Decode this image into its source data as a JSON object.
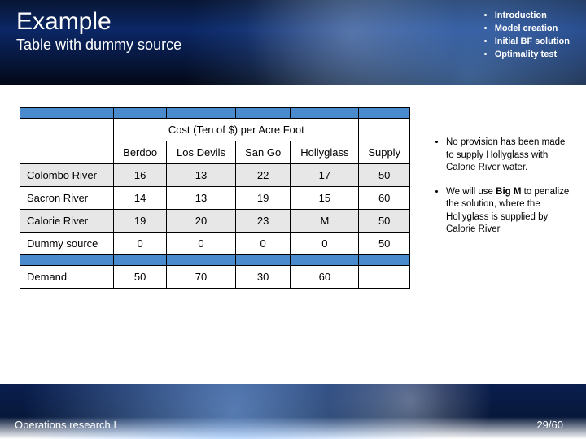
{
  "header": {
    "title": "Example",
    "subtitle": "Table with dummy source",
    "agenda": [
      "Introduction",
      "Model creation",
      "Initial BF solution",
      "Optimality test"
    ]
  },
  "table": {
    "cost_caption": "Cost (Ten of $) per Acre Foot",
    "col_headers": {
      "c1": "Berdoo",
      "c2": "Los Devils",
      "c3": "San Go",
      "c4": "Hollyglass",
      "c5": "Supply"
    },
    "rows": [
      {
        "label": "Colombo River",
        "v": [
          "16",
          "13",
          "22",
          "17",
          "50"
        ]
      },
      {
        "label": "Sacron River",
        "v": [
          "14",
          "13",
          "19",
          "15",
          "60"
        ]
      },
      {
        "label": "Calorie River",
        "v": [
          "19",
          "20",
          "23",
          "M",
          "50"
        ]
      },
      {
        "label": "Dummy source",
        "v": [
          "0",
          "0",
          "0",
          "0",
          "50"
        ]
      }
    ],
    "demand_label": "Demand",
    "demand": [
      "50",
      "70",
      "30",
      "60",
      ""
    ]
  },
  "notes": {
    "n1_pre": "No provision has been made to supply Hollyglass with Calorie River water.",
    "n2_pre": "We will use ",
    "n2_strong": "Big M",
    "n2_post": " to penalize the solution, where the Hollyglass is supplied by Calorie River"
  },
  "footer": {
    "dept": "Operations research I",
    "page": "29/60"
  },
  "chart_data": {
    "type": "table",
    "title": "Cost (Ten of $) per Acre Foot",
    "columns": [
      "Berdoo",
      "Los Devils",
      "San Go",
      "Hollyglass",
      "Supply"
    ],
    "rows": [
      {
        "source": "Colombo River",
        "Berdoo": 16,
        "Los Devils": 13,
        "San Go": 22,
        "Hollyglass": 17,
        "Supply": 50
      },
      {
        "source": "Sacron River",
        "Berdoo": 14,
        "Los Devils": 13,
        "San Go": 19,
        "Hollyglass": 15,
        "Supply": 60
      },
      {
        "source": "Calorie River",
        "Berdoo": 19,
        "Los Devils": 20,
        "San Go": 23,
        "Hollyglass": "M",
        "Supply": 50
      },
      {
        "source": "Dummy source",
        "Berdoo": 0,
        "Los Devils": 0,
        "San Go": 0,
        "Hollyglass": 0,
        "Supply": 50
      }
    ],
    "demand": {
      "Berdoo": 50,
      "Los Devils": 70,
      "San Go": 30,
      "Hollyglass": 60
    }
  }
}
